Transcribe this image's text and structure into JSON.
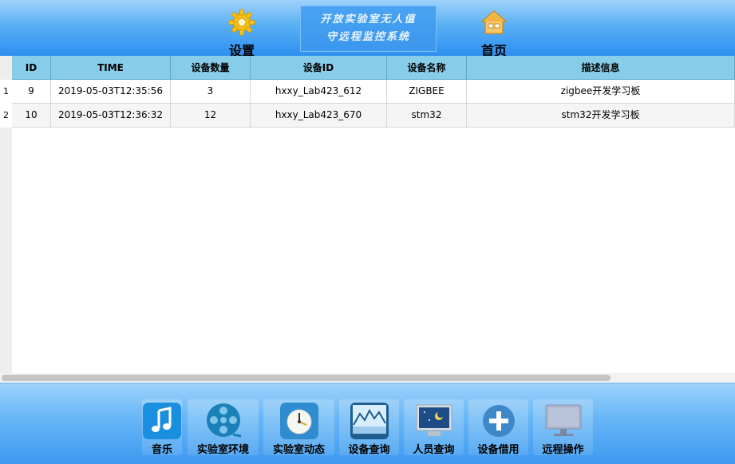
{
  "header": {
    "settings_label": "设置",
    "home_label": "首页",
    "banner_line1": "开放实验室无人值",
    "banner_line2": "守远程监控系统"
  },
  "table": {
    "columns": [
      "ID",
      "TIME",
      "设备数量",
      "设备ID",
      "设备名称",
      "描述信息"
    ],
    "rows": [
      {
        "num": "1",
        "cells": [
          "9",
          "2019-05-03T12:35:56",
          "3",
          "hxxy_Lab423_612",
          "ZIGBEE",
          "zigbee开发学习板"
        ]
      },
      {
        "num": "2",
        "cells": [
          "10",
          "2019-05-03T12:36:32",
          "12",
          "hxxy_Lab423_670",
          "stm32",
          "stm32开发学习板"
        ]
      }
    ]
  },
  "footer": {
    "buttons": [
      {
        "label": "音乐",
        "icon": "music-note-icon"
      },
      {
        "label": "实验室环境",
        "icon": "film-reel-icon"
      },
      {
        "label": "实验室动态",
        "icon": "clock-icon"
      },
      {
        "label": "设备查询",
        "icon": "chart-icon"
      },
      {
        "label": "人员查询",
        "icon": "night-sky-monitor-icon"
      },
      {
        "label": "设备借用",
        "icon": "plus-icon"
      },
      {
        "label": "远程操作",
        "icon": "monitor-icon"
      }
    ]
  },
  "colors": {
    "header_gradient_top": "#9fd2fb",
    "header_gradient_bottom": "#2d8ff0",
    "table_header_bg": "#87cdea",
    "row_alt_bg": "#f5f5f5"
  }
}
